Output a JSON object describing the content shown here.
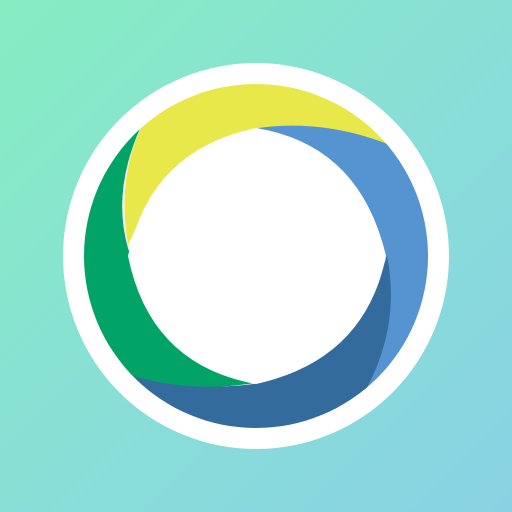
{
  "icon": {
    "name": "aperture-ring-logo-icon",
    "colors": {
      "background_start": "#86EDC2",
      "background_end": "#89D2E4",
      "ring_outer": "#FFFFFF",
      "center": "#FFFFFF",
      "segment_yellow": "#E8E84A",
      "segment_light_blue": "#5693D1",
      "segment_dark_blue": "#336B9C",
      "segment_green": "#01A466"
    }
  }
}
